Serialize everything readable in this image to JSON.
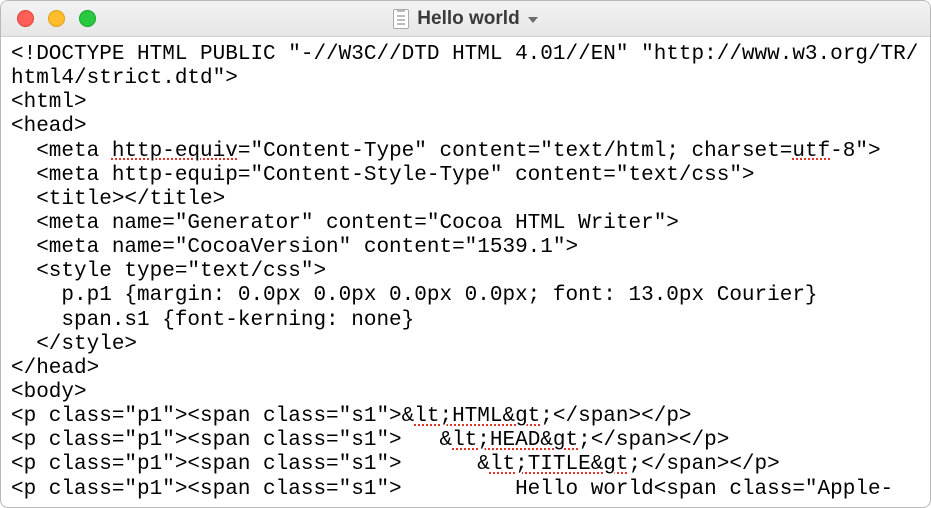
{
  "titlebar": {
    "title": "Hello world",
    "traffic": {
      "close": "close",
      "minimize": "minimize",
      "zoom": "zoom"
    }
  },
  "code": {
    "l1a": "<!DOCTYPE HTML PUBLIC \"-//W3C//DTD HTML 4.01//EN\" \"http://www.w3.org/TR/",
    "l2a": "html4/strict.dtd\">",
    "l3a": "<html>",
    "l4a": "<head>",
    "l5a": "  <meta ",
    "l5b": "http-equiv",
    "l5c": "=\"Content-Type\" content=\"text/html; charset=",
    "l5d": "utf",
    "l5e": "-8\">",
    "l6a": "  <meta http-equip=\"Content-Style-Type\" content=\"text/css\">",
    "l7a": "  <title></title>",
    "l8a": "  <meta name=\"Generator\" content=\"Cocoa HTML Writer\">",
    "l9a": "  <meta name=\"CocoaVersion\" content=\"1539.1\">",
    "l10a": "  <style type=\"text/css\">",
    "l11a": "    p.p1 {margin: 0.0px 0.0px 0.0px 0.0px; font: 13.0px Courier}",
    "l12a": "    span.s1 {font-kerning: none}",
    "l13a": "  </style>",
    "l14a": "</head>",
    "l15a": "<body>",
    "l16a": "<p class=\"p1\"><span class=\"s1\">&",
    "l16b": "lt;HTML&gt",
    "l16c": ";</span></p>",
    "l17a": "<p class=\"p1\"><span class=\"s1\">   &",
    "l17b": "lt;HEAD&gt",
    "l17c": ";</span></p>",
    "l18a": "<p class=\"p1\"><span class=\"s1\">      &",
    "l18b": "lt;TITLE&gt",
    "l18c": ";</span></p>",
    "l19a": "<p class=\"p1\"><span class=\"s1\">         Hello world<span class=\"Apple-"
  }
}
